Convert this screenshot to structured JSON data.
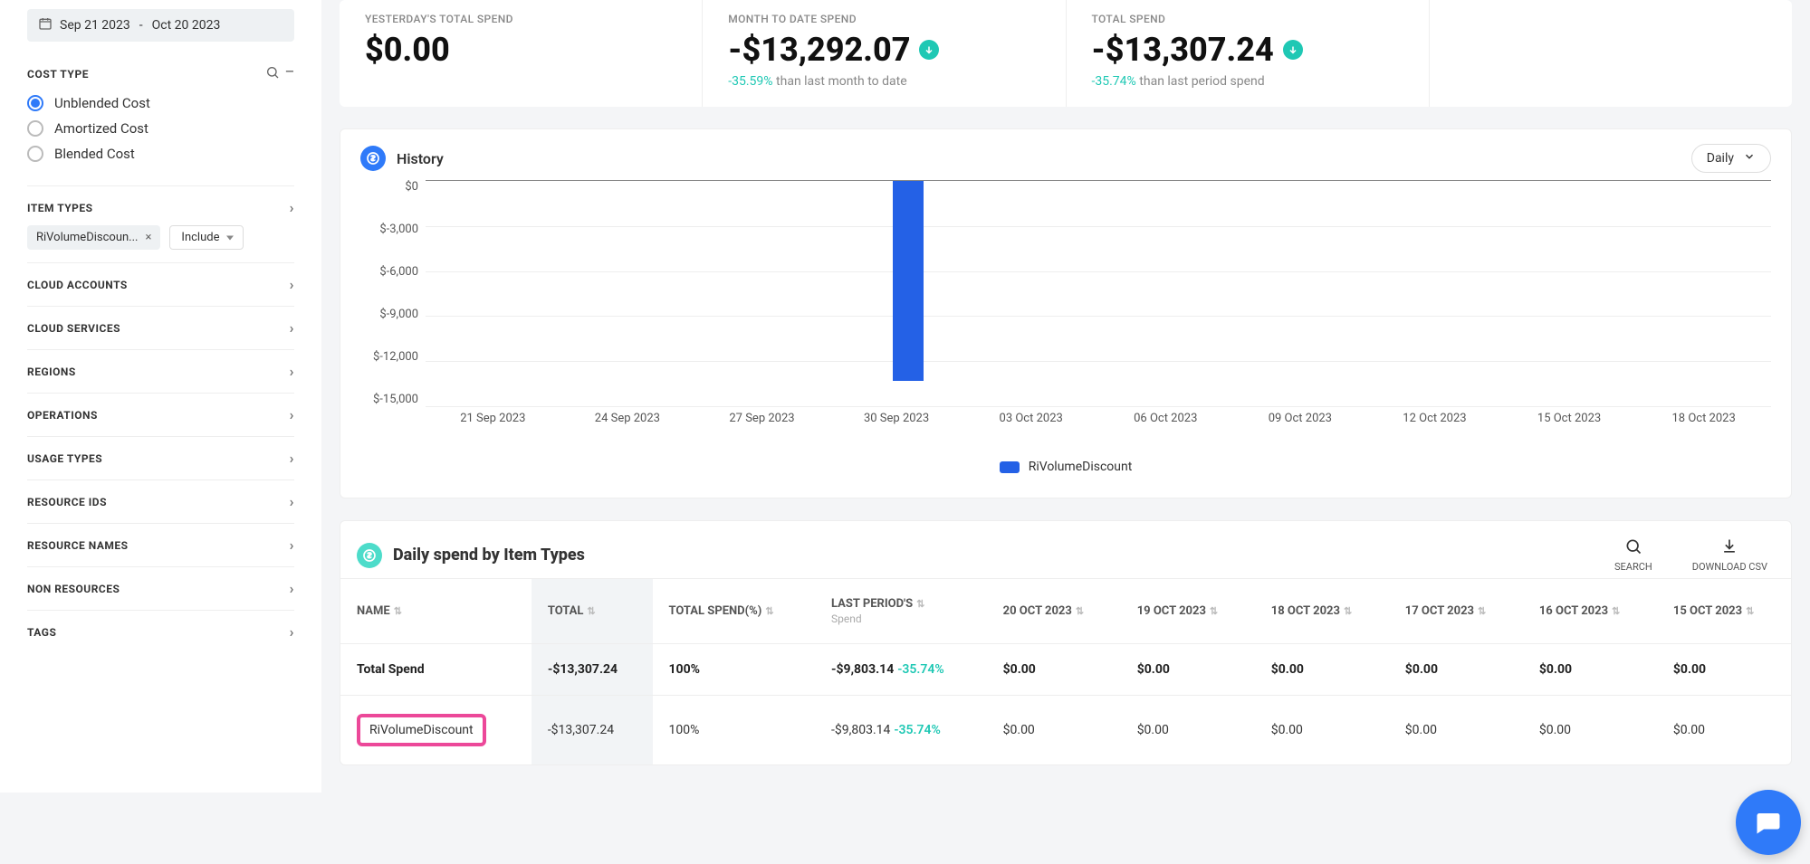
{
  "sidebar": {
    "date_from": "Sep 21 2023",
    "date_separator": "-",
    "date_to": "Oct 20 2023",
    "cost_type_label": "COST TYPE",
    "cost_type_options": [
      "Unblended Cost",
      "Amortized Cost",
      "Blended Cost"
    ],
    "item_types_label": "ITEM TYPES",
    "item_types_chip": "RiVolumeDiscoun...",
    "include_label": "Include",
    "sections": [
      "CLOUD ACCOUNTS",
      "CLOUD SERVICES",
      "REGIONS",
      "OPERATIONS",
      "USAGE TYPES",
      "RESOURCE IDS",
      "RESOURCE NAMES",
      "NON RESOURCES",
      "TAGS"
    ]
  },
  "kpis": {
    "yesterday": {
      "title": "YESTERDAY'S TOTAL SPEND",
      "value": "$0.00"
    },
    "mtd": {
      "title": "MONTH TO DATE SPEND",
      "value": "-$13,292.07",
      "pct": "-35.59%",
      "txt": "than last month to date"
    },
    "total": {
      "title": "TOTAL SPEND",
      "value": "-$13,307.24",
      "pct": "-35.74%",
      "txt": "than last period spend"
    }
  },
  "history": {
    "title": "History",
    "interval": "Daily",
    "legend": "RiVolumeDiscount"
  },
  "table": {
    "title": "Daily spend by Item Types",
    "search": "SEARCH",
    "download": "DOWNLOAD CSV",
    "headers": {
      "name": "NAME",
      "total": "TOTAL",
      "total_spend_pct": "TOTAL SPEND(%)",
      "last_period": "LAST PERIOD'S",
      "last_period_sub": "Spend",
      "d20": "20 OCT 2023",
      "d19": "19 OCT 2023",
      "d18": "18 OCT 2023",
      "d17": "17 OCT 2023",
      "d16": "16 OCT 2023",
      "d15": "15 OCT 2023"
    },
    "rows": [
      {
        "name": "Total Spend",
        "total": "-$13,307.24",
        "total_pct": "100%",
        "last_period": "-$9,803.14",
        "last_period_pct": "-35.74%",
        "d20": "$0.00",
        "d19": "$0.00",
        "d18": "$0.00",
        "d17": "$0.00",
        "d16": "$0.00",
        "d15": "$0.00"
      },
      {
        "name": "RiVolumeDiscount",
        "total": "-$13,307.24",
        "total_pct": "100%",
        "last_period": "-$9,803.14",
        "last_period_pct": "-35.74%",
        "d20": "$0.00",
        "d19": "$0.00",
        "d18": "$0.00",
        "d17": "$0.00",
        "d16": "$0.00",
        "d15": "$0.00"
      }
    ]
  },
  "chart_data": {
    "type": "bar",
    "categories": [
      "21 Sep 2023",
      "24 Sep 2023",
      "27 Sep 2023",
      "30 Sep 2023",
      "03 Oct 2023",
      "06 Oct 2023",
      "09 Oct 2023",
      "12 Oct 2023",
      "15 Oct 2023",
      "18 Oct 2023"
    ],
    "series": [
      {
        "name": "RiVolumeDiscount",
        "values": [
          0,
          0,
          0,
          0,
          0,
          0,
          0,
          0,
          0,
          0
        ]
      }
    ],
    "single_bar": {
      "category": "01 Oct 2023",
      "value": -13307.24,
      "position_fraction": 0.347
    },
    "y_ticks": [
      "$0",
      "$-3,000",
      "$-6,000",
      "$-9,000",
      "$-12,000",
      "$-15,000"
    ],
    "ylim": [
      -15000,
      0
    ],
    "ylabel": "",
    "xlabel": "",
    "title": "",
    "legend_position": "bottom"
  }
}
